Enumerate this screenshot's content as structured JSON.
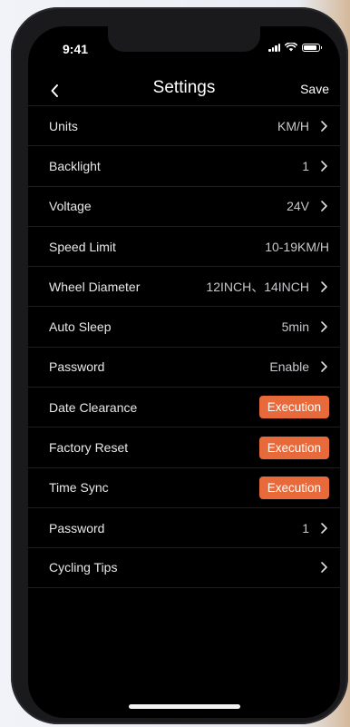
{
  "status": {
    "time": "9:41"
  },
  "nav": {
    "title": "Settings",
    "save_label": "Save"
  },
  "rows": [
    {
      "label": "Units",
      "value": "KM/H",
      "chevron": true
    },
    {
      "label": "Backlight",
      "value": "1",
      "chevron": true
    },
    {
      "label": "Voltage",
      "value": "24V",
      "chevron": true
    },
    {
      "label": "Speed Limit",
      "value": "10-19KM/H",
      "chevron": false
    },
    {
      "label": "Wheel Diameter",
      "value": "12INCH、14INCH",
      "chevron": true
    },
    {
      "label": "Auto Sleep",
      "value": "5min",
      "chevron": true
    },
    {
      "label": "Password",
      "value": "Enable",
      "chevron": true
    },
    {
      "label": "Date Clearance",
      "button": "Execution"
    },
    {
      "label": "Factory Reset",
      "button": "Execution"
    },
    {
      "label": "Time Sync",
      "button": "Execution"
    },
    {
      "label": "Password",
      "value": "1",
      "chevron": true
    },
    {
      "label": "Cycling Tips",
      "value": "",
      "chevron": true
    }
  ],
  "colors": {
    "accent": "#e8693a",
    "background": "#000000"
  },
  "icons": {
    "back": "chevron-left-icon",
    "row": "chevron-right-icon"
  }
}
